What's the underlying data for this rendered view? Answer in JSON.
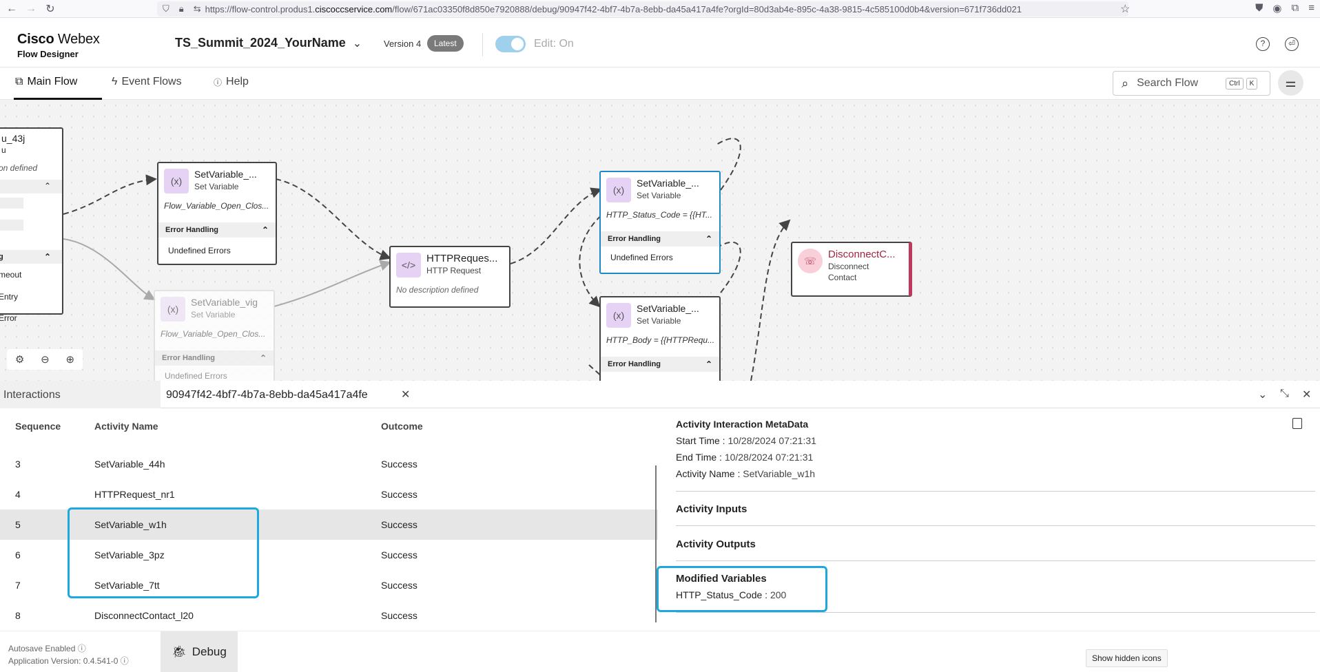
{
  "browser": {
    "url_prefix": "https://flow-control.produs1.",
    "url_domain": "ciscoccservice.com",
    "url_suffix": "/flow/671ac03350f8d850e7920888/debug/90947f42-4bf7-4b7a-8ebb-da45a417a4fe?orgId=80d3ab4e-895c-4a38-9815-4c585100d0b4&version=671f736dd021"
  },
  "header": {
    "brand_line1": "Cisco",
    "brand_line1b": "Webex",
    "brand_line2": "Flow Designer",
    "flow_name": "TS_Summit_2024_YourName",
    "version": "Version 4",
    "latest_badge": "Latest",
    "edit_label": "Edit: On"
  },
  "tabs": [
    {
      "label": "Main Flow"
    },
    {
      "label": "Event Flows"
    },
    {
      "label": "Help"
    }
  ],
  "search": {
    "placeholder": "Search Flow",
    "kbd1": "Ctrl",
    "kbd2": "K"
  },
  "canvas": {
    "left_node": {
      "title": "u_43j",
      "sub": "u",
      "desc": "on defined",
      "items": [
        "meout",
        "Entry",
        "Error"
      ],
      "section": "g"
    },
    "node1": {
      "title": "SetVariable_...",
      "sub": "Set Variable",
      "desc": "Flow_Variable_Open_Clos...",
      "err_hdr": "Error Handling",
      "err": "Undefined Errors"
    },
    "node2": {
      "title": "SetVariable_vig",
      "sub": "Set Variable",
      "desc": "Flow_Variable_Open_Clos...",
      "err_hdr": "Error Handling",
      "err": "Undefined Errors"
    },
    "node3": {
      "title": "HTTPReques...",
      "sub": "HTTP Request",
      "desc": "No description defined"
    },
    "node4": {
      "title": "SetVariable_...",
      "sub": "Set Variable",
      "desc": "HTTP_Status_Code = {{HT...",
      "err_hdr": "Error Handling",
      "err": "Undefined Errors"
    },
    "node5": {
      "title": "SetVariable_...",
      "sub": "Set Variable",
      "desc": "HTTP_Body = {{HTTPRequ...",
      "err_hdr": "Error Handling"
    },
    "node6": {
      "title": "DisconnectC...",
      "sub1": "Disconnect",
      "sub2": "Contact"
    }
  },
  "panel": {
    "tab_interactions": "Interactions",
    "tab_id": "90947f42-4bf7-4b7a-8ebb-da45a417a4fe",
    "col_sequence": "Sequence",
    "col_activity": "Activity Name",
    "col_outcome": "Outcome",
    "rows": [
      {
        "seq": "3",
        "name": "SetVariable_44h",
        "outcome": "Success"
      },
      {
        "seq": "4",
        "name": "HTTPRequest_nr1",
        "outcome": "Success"
      },
      {
        "seq": "5",
        "name": "SetVariable_w1h",
        "outcome": "Success"
      },
      {
        "seq": "6",
        "name": "SetVariable_3pz",
        "outcome": "Success"
      },
      {
        "seq": "7",
        "name": "SetVariable_7tt",
        "outcome": "Success"
      },
      {
        "seq": "8",
        "name": "DisconnectContact_l20",
        "outcome": "Success"
      }
    ],
    "meta_title": "Activity Interaction MetaData",
    "start_label": "Start Time",
    "start_value": "10/28/2024 07:21:31",
    "end_label": "End Time",
    "end_value": "10/28/2024 07:21:31",
    "name_label": "Activity Name",
    "name_value": "SetVariable_w1h",
    "inputs": "Activity Inputs",
    "outputs": "Activity Outputs",
    "modified": "Modified Variables",
    "var_name": "HTTP_Status_Code",
    "var_value": "200"
  },
  "footer": {
    "autosave": "Autosave Enabled",
    "app_version": "Application Version: 0.4.541-0",
    "debug": "Debug",
    "hidden_icons": "Show hidden icons"
  }
}
